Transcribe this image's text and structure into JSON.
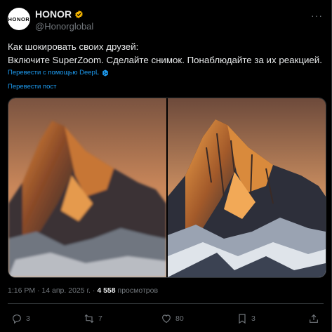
{
  "author": {
    "avatar_text": "HONOR",
    "name": "HONOR",
    "handle": "@Honorglobal",
    "verified_color": "#f4b400"
  },
  "post": {
    "line1": "Как шокировать своих друзей:",
    "line2": "Включите SuperZoom. Сделайте снимок. Понаблюдайте за их реакцией.",
    "deepl_label": "Перевести с помощью DeepL",
    "translate_label": "Перевести пост"
  },
  "meta": {
    "time": "1:16 PM · 14 апр. 2025 г. · ",
    "views_count": "4 558",
    "views_label": "просмотров"
  },
  "actions": {
    "replies": "3",
    "reposts": "7",
    "likes": "80",
    "bookmarks": "3"
  },
  "colors": {
    "background": "#000000",
    "text": "#e7e9ea",
    "muted": "#71767b",
    "link": "#1d9bf0",
    "border": "#2f3336"
  }
}
